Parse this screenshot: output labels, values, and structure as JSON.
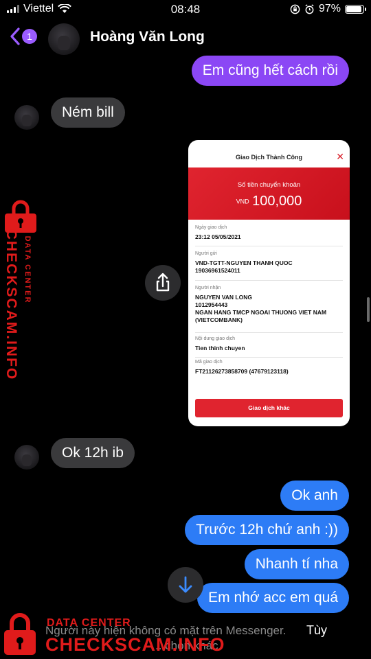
{
  "status_bar": {
    "carrier": "Viettel",
    "time": "08:48",
    "battery": "97%"
  },
  "header": {
    "back_badge": "1",
    "contact_name": "Hoàng Văn Long"
  },
  "messages": {
    "m1": "Em cũng hết cách rồi",
    "m2": "Ném bill",
    "m3": "Ok 12h ib",
    "m4": "Ok anh",
    "m5": "Trước 12h chứ anh :))",
    "m6": "Nhanh tí nha",
    "m7": "Em nhớ acc em quá"
  },
  "receipt": {
    "title": "Giao Dịch Thành Công",
    "amount_label": "Số tiền chuyển khoản",
    "currency": "VND",
    "amount": "100,000",
    "fields": [
      {
        "key": "Ngày giao dịch",
        "value": "23:12 05/05/2021"
      },
      {
        "key": "Người gửi",
        "value": "VND-TGTT-NGUYEN THANH QUOC\n19036961524011"
      },
      {
        "key": "Người nhận",
        "value": "NGUYEN VAN LONG\n1012954443\nNGAN HANG TMCP NGOAI THUONG VIET NAM\n(VIETCOMBANK)"
      },
      {
        "key": "Nội dung giao dịch",
        "value": "Tien thinh chuyen"
      },
      {
        "key": "Mã giao dịch",
        "value": "FT21126273858709 (47679123118)"
      }
    ],
    "button": "Giao dịch khác"
  },
  "footer": {
    "notice": "Người này hiện không có mặt trên Messenger.",
    "notice_tail": "...chọn khác",
    "options": "Tùy"
  },
  "watermark": {
    "small": "DATA CENTER",
    "big": "CHECKSCAM.INFO"
  },
  "colors": {
    "accent_purple": "#8b47f5",
    "sent_blue": "#2d7cf6",
    "received_gray": "#3a3a3c",
    "watermark_red": "#e01b1b",
    "receipt_red": "#e0242f"
  },
  "icons": [
    "back-chevron-icon",
    "wifi-icon",
    "signal-icon",
    "lock-rotation-icon",
    "alarm-icon",
    "battery-icon",
    "share-icon",
    "arrow-down-icon",
    "close-icon",
    "lock-icon"
  ]
}
